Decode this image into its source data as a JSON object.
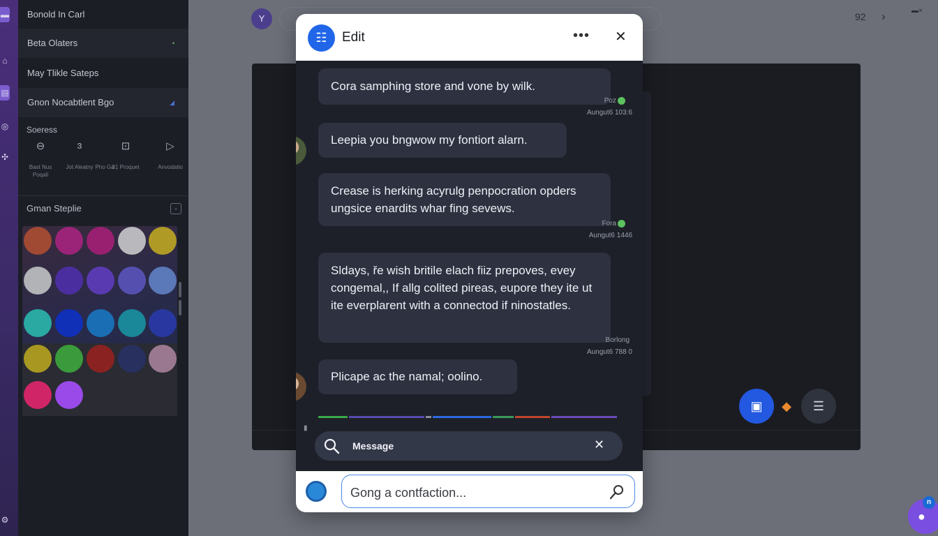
{
  "colors": {
    "accent": "#2166e8",
    "rail": "#4a2e7a",
    "sidebar": "#1c1e26",
    "bubble": "#2d3140",
    "online": "#5cc15e",
    "chat_fab": "#7a4ee0"
  },
  "sidebar": {
    "items": [
      {
        "label": "Bonold In Carl",
        "mark": ""
      },
      {
        "label": "Beta Olaters",
        "mark": "•"
      },
      {
        "label": "May Tlikle Sateps",
        "mark": ""
      },
      {
        "label": "Gnon Nocabtlent Bgo",
        "mark": "◢"
      }
    ],
    "tools_heading": "Soeress",
    "tools": [
      {
        "icon": "pin-icon",
        "label": "Bast Nus Poqali"
      },
      {
        "icon": "loop-icon",
        "label": "Jot Aleatny"
      },
      {
        "icon": "pencil-icon",
        "label": "Pho Ga"
      },
      {
        "icon": "image-icon",
        "label": "31 Proquet"
      },
      {
        "icon": "play-icon",
        "label": "Anvodatio"
      }
    ],
    "section_heading": "Gman Steplie",
    "swatches": [
      "#a04a34",
      "#9b2478",
      "#992070",
      "#b9b9bd",
      "#b09a26",
      "#b1b3b6",
      "#4a2ea0",
      "#5a3ab0",
      "#5550b0",
      "#5b78b8",
      "#2aa8a2",
      "#1030b8",
      "#1a6eb4",
      "#1a8898",
      "#2838a0",
      "#a89822",
      "#3a9a3c",
      "#8a2222",
      "#283060",
      "#9a7890",
      "#d02668",
      "#9a4ae8"
    ]
  },
  "topbar": {
    "avatar_glyph": "Y",
    "count": "92",
    "chevron": "›"
  },
  "modal": {
    "title": "Edit",
    "more": "•••",
    "close": "✕",
    "messages": [
      {
        "text": "Cora samphing store and vone by wilk.",
        "sender": "Poz",
        "time": "Aungut6 103:6",
        "online": true
      },
      {
        "text": "Leepia you bngwow my fontiort alarn.",
        "sender": "",
        "time": "",
        "online": false
      },
      {
        "text": "Crease is herking acyrulg penpocration opders ungsice enardits whar fing sevews.",
        "sender": "Fora",
        "time": "Aungut6 1446",
        "online": true
      },
      {
        "text": "Sldays, ře wish britile elach fiiz prepoves, evey congemal,, If allg colited pireas, eupore they ite ut ite everplarent with a connectod if ninostatles.",
        "sender": "Borlong",
        "time": "Aungut6 788 0",
        "online": false
      },
      {
        "text": "Plicape ac the namal; oolino.",
        "sender": "",
        "time": "",
        "online": false
      }
    ],
    "search": {
      "value": "Message",
      "clear": "✕"
    },
    "composer": {
      "placeholder": "Gong a contfaction..."
    }
  },
  "chat_badge": "n"
}
